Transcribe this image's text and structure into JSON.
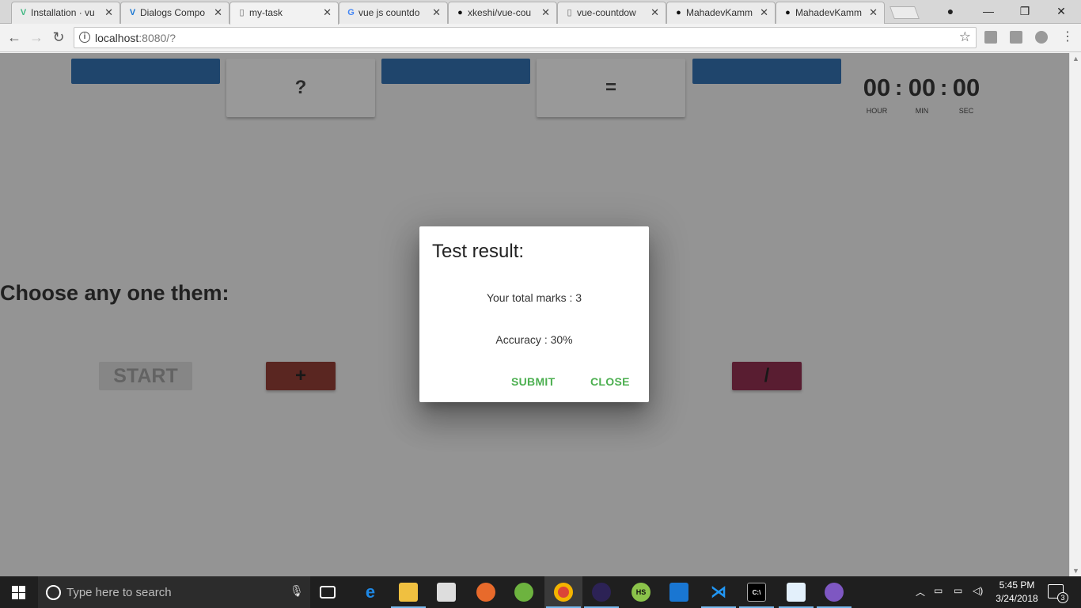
{
  "browser": {
    "tabs": [
      {
        "title": "Installation · vu",
        "icon": "vue-icon",
        "active": false
      },
      {
        "title": "Dialogs Compo",
        "icon": "vuetify-icon",
        "active": false
      },
      {
        "title": "my-task",
        "icon": "page-icon",
        "active": true
      },
      {
        "title": "vue js countdo",
        "icon": "google-icon",
        "active": false
      },
      {
        "title": "xkeshi/vue-cou",
        "icon": "github-icon",
        "active": false
      },
      {
        "title": "vue-countdow",
        "icon": "page-icon",
        "active": false
      },
      {
        "title": "MahadevKamm",
        "icon": "github-icon",
        "active": false
      },
      {
        "title": "MahadevKamm",
        "icon": "github-icon",
        "active": false
      }
    ],
    "url_host": "localhost",
    "url_rest": ":8080/?"
  },
  "app": {
    "cards": {
      "operator": "?",
      "equals": "="
    },
    "timer": {
      "hours": "00",
      "minutes": "00",
      "seconds": "00",
      "hour_label": "HOUR",
      "min_label": "MIN",
      "sec_label": "SEC"
    },
    "choose_heading": "Choose any one them:",
    "start_label": "START",
    "operators": [
      {
        "symbol": "+",
        "color": "#8b2b22"
      },
      {
        "symbol": "/",
        "color": "#8a1a3f"
      }
    ],
    "blue_color": "#1e64ad"
  },
  "dialog": {
    "title": "Test result:",
    "marks_text": "Your total marks : 3",
    "accuracy_text": "Accuracy : 30%",
    "submit_label": "SUBMIT",
    "close_label": "CLOSE",
    "button_color": "#4caf50"
  },
  "taskbar": {
    "search_placeholder": "Type here to search",
    "time": "5:45 PM",
    "date": "3/24/2018",
    "notification_count": "3"
  }
}
